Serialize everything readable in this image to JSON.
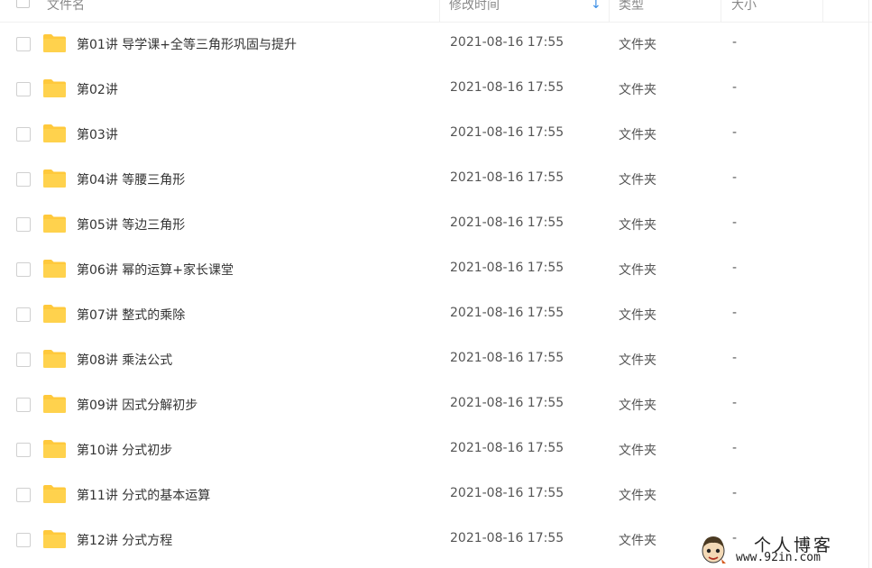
{
  "header": {
    "name_label": "文件名",
    "time_label": "修改时间",
    "type_label": "类型",
    "size_label": "大小",
    "sort_icon": "sort-down-arrow-icon",
    "accent_color": "#3a8ee6"
  },
  "files": [
    {
      "name": "第01讲 导学课+全等三角形巩固与提升",
      "modified": "2021-08-16 17:55",
      "type": "文件夹",
      "size": "-"
    },
    {
      "name": "第02讲",
      "modified": "2021-08-16 17:55",
      "type": "文件夹",
      "size": "-"
    },
    {
      "name": "第03讲",
      "modified": "2021-08-16 17:55",
      "type": "文件夹",
      "size": "-"
    },
    {
      "name": "第04讲 等腰三角形",
      "modified": "2021-08-16 17:55",
      "type": "文件夹",
      "size": "-"
    },
    {
      "name": "第05讲 等边三角形",
      "modified": "2021-08-16 17:55",
      "type": "文件夹",
      "size": "-"
    },
    {
      "name": "第06讲 幂的运算+家长课堂",
      "modified": "2021-08-16 17:55",
      "type": "文件夹",
      "size": "-"
    },
    {
      "name": "第07讲 整式的乘除",
      "modified": "2021-08-16 17:55",
      "type": "文件夹",
      "size": "-"
    },
    {
      "name": "第08讲 乘法公式",
      "modified": "2021-08-16 17:55",
      "type": "文件夹",
      "size": "-"
    },
    {
      "name": "第09讲 因式分解初步",
      "modified": "2021-08-16 17:55",
      "type": "文件夹",
      "size": "-"
    },
    {
      "name": "第10讲 分式初步",
      "modified": "2021-08-16 17:55",
      "type": "文件夹",
      "size": "-"
    },
    {
      "name": "第11讲 分式的基本运算",
      "modified": "2021-08-16 17:55",
      "type": "文件夹",
      "size": "-"
    },
    {
      "name": "第12讲 分式方程",
      "modified": "2021-08-16 17:55",
      "type": "文件夹",
      "size": "-"
    }
  ],
  "icons": {
    "folder": "folder-icon",
    "checkbox": "checkbox-icon"
  },
  "folder_color": "#FFC93C",
  "watermark": {
    "title": "个人博客",
    "url": "www.92in.com"
  }
}
